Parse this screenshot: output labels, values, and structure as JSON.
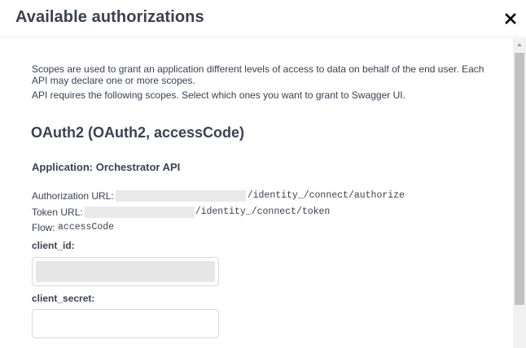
{
  "header": {
    "title": "Available authorizations",
    "close_icon": "close-icon"
  },
  "description": {
    "line1": "Scopes are used to grant an application different levels of access to data on behalf of the end user. Each API may declare one or more scopes.",
    "line2": "API requires the following scopes. Select which ones you want to grant to Swagger UI."
  },
  "oauth": {
    "title": "OAuth2 (OAuth2, accessCode)",
    "application": "Application: Orchestrator API",
    "authorization_url_label": "Authorization URL:",
    "authorization_url_path": "/identity_/connect/authorize",
    "token_url_label": "Token URL:",
    "token_url_path": "/identity_/connect/token",
    "flow_label": "Flow:",
    "flow_value": "accessCode"
  },
  "form": {
    "client_id_label": "client_id:",
    "client_id_value": "",
    "client_secret_label": "client_secret:",
    "client_secret_value": ""
  },
  "colors": {
    "text": "#3b4151",
    "redaction": "#e9e9e9",
    "scrollbar_thumb": "#c1c1c1"
  }
}
